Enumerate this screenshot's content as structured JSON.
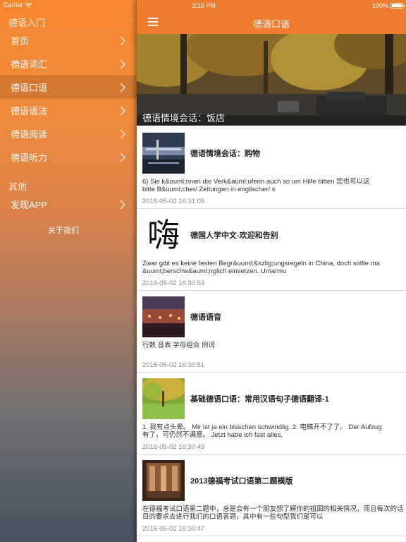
{
  "status": {
    "carrier": "Carrier",
    "time": "3:15 PM",
    "battery": "100%"
  },
  "sidebar": {
    "section1": "德语入门",
    "items": [
      {
        "label": "首页"
      },
      {
        "label": "德语词汇"
      },
      {
        "label": "德语口语",
        "active": true
      },
      {
        "label": "德语语法"
      },
      {
        "label": "德语阅读"
      },
      {
        "label": "德语听力"
      }
    ],
    "section2": "其他",
    "other_items": [
      {
        "label": "发现APP"
      }
    ],
    "about": "关于我们"
  },
  "navbar": {
    "title": "德语口语"
  },
  "hero": {
    "caption": "德语情境会话：饭店"
  },
  "articles": [
    {
      "title": "德语情境会话：购物",
      "summary": "      6) Sie k&ouml;nnen die Verk&auml;uferin auch so um Hilfe bitten 您也可以这\nbitte B&uuml;cher/ Zeitungen in englischer/ s",
      "date": "2016-05-02 16:31:05"
    },
    {
      "title": "德国人学中文-欢迎和告别",
      "summary": "Zwar gibt es keine festen Begr&uuml;&szlig;ungsregeln in China, doch sollte ma\n&uuml;berschw&auml;nglich einsetzen. Umarmu",
      "date": "2016-05-02 16:30:53"
    },
    {
      "title": "德语语音",
      "summary": "行数 音表 字母组合 例词",
      "date": "2016-05-02 16:30:51"
    },
    {
      "title": "基础德语口语：常用汉语句子德语翻译-1",
      "summary": "1.  我有点头晕。 Mir ist ja ein bisschen schwindlig. 2.  电梯开不了了。 Der Aufzug\n有了，可仍然不满意。 Jetzt habe ich fast alles,",
      "date": "2016-05-02 16:30:49"
    },
    {
      "title": "2013德福考试口语第二题模版",
      "summary": "在德福考试口语第二题中，总是会有一个朋友想了解你的祖国的相关情况，而且每次的话\n目的要求去进行我们的口语答题，其中有一些句型我们是可以",
      "date": "2016-05-02 16:30:47"
    }
  ],
  "thumb2_glyph": "嗨"
}
